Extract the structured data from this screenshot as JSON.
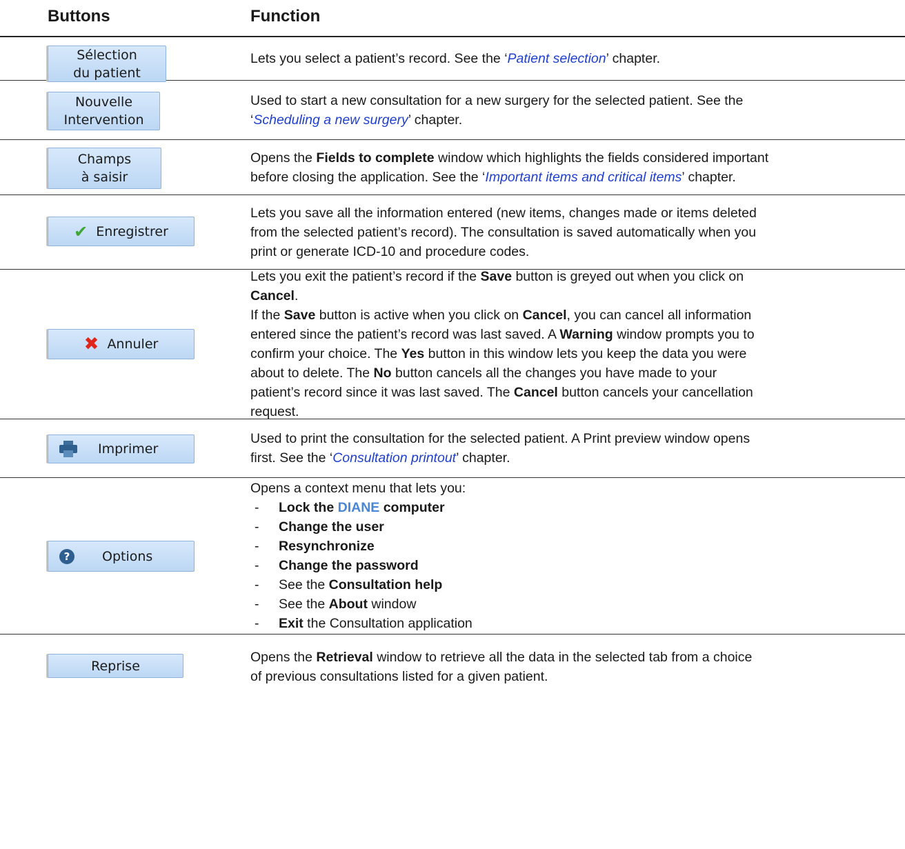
{
  "header": {
    "buttons": "Buttons",
    "function": "Function"
  },
  "rows": [
    {
      "button": {
        "line1": "Sélection",
        "line2": "du patient"
      },
      "desc": {
        "a": "Lets you select a patient’s record. See the ‘",
        "link": "Patient selection",
        "b": "’ chapter."
      }
    },
    {
      "button": {
        "line1": "Nouvelle",
        "line2": "Intervention"
      },
      "desc": {
        "l1": "Used to start a new consultation for a new surgery for the selected patient. See the",
        "a": "‘",
        "link": "Scheduling a new surgery",
        "b": "’ chapter."
      }
    },
    {
      "button": {
        "line1": "Champs",
        "line2": "à saisir"
      },
      "desc": {
        "a": "Opens the ",
        "bold": "Fields to complete",
        "b": " window which highlights the fields considered important",
        "c": "before closing the application. See the ‘",
        "link": "Important items and critical items",
        "d": "’ chapter."
      }
    },
    {
      "button": {
        "label": "Enregistrer",
        "icon": "check-icon"
      },
      "desc": {
        "l1": "Lets you save all the information entered (new items, changes made or items deleted",
        "l2": "from the selected patient’s record). The consultation is saved automatically when you",
        "l3": "print or generate ICD-10 and procedure codes."
      }
    },
    {
      "button": {
        "label": "Annuler",
        "icon": "cross-icon"
      },
      "desc": {
        "p1a": "Lets you exit the patient’s record if the ",
        "save1": "Save",
        "p1b": " button is greyed out when you click on",
        "cancel1": "Cancel",
        "p1c": ".",
        "p2a": "If the ",
        "save2": "Save",
        "p2b": " button is active when you click on ",
        "cancel2": "Cancel",
        "p2c": ", you can cancel all information",
        "p3": "entered since the patient’s record was last saved. A ",
        "warning": "Warning",
        "p3b": " window prompts you to",
        "p4a": "confirm your choice. The ",
        "yes": "Yes",
        "p4b": " button in this window lets you keep the data you were",
        "p5a": "about to delete. The ",
        "no": "No",
        "p5b": " button cancels all the changes you have made to your",
        "p6a": "patient’s record since it was last saved. The ",
        "cancel3": "Cancel",
        "p6b": " button cancels your cancellation",
        "p7": "request."
      }
    },
    {
      "button": {
        "label": "Imprimer",
        "icon": "printer-icon"
      },
      "desc": {
        "l1": "Used to print the consultation for the selected patient. A Print preview window opens",
        "a": "first. See the ‘",
        "link": "Consultation printout",
        "b": "’ chapter."
      }
    },
    {
      "button": {
        "label": "Options",
        "icon": "help-icon"
      },
      "desc": {
        "intro": "Opens a context menu that lets you:",
        "i1a": "Lock the ",
        "i1diane": "DIANE",
        "i1b": " computer",
        "i2": "Change the user",
        "i3": "Resynchronize",
        "i4": "Change the password",
        "i5a": "See the ",
        "i5b": "Consultation help",
        "i6a": "See the ",
        "i6b": "About",
        "i6c": " window",
        "i7a": "Exit",
        "i7b": " the Consultation application"
      }
    },
    {
      "button": {
        "label": "Reprise"
      },
      "desc": {
        "a": "Opens the ",
        "bold": "Retrieval",
        "b": " window to retrieve all the data in the selected tab from a choice",
        "c": "of previous consultations listed for a given patient."
      }
    }
  ]
}
